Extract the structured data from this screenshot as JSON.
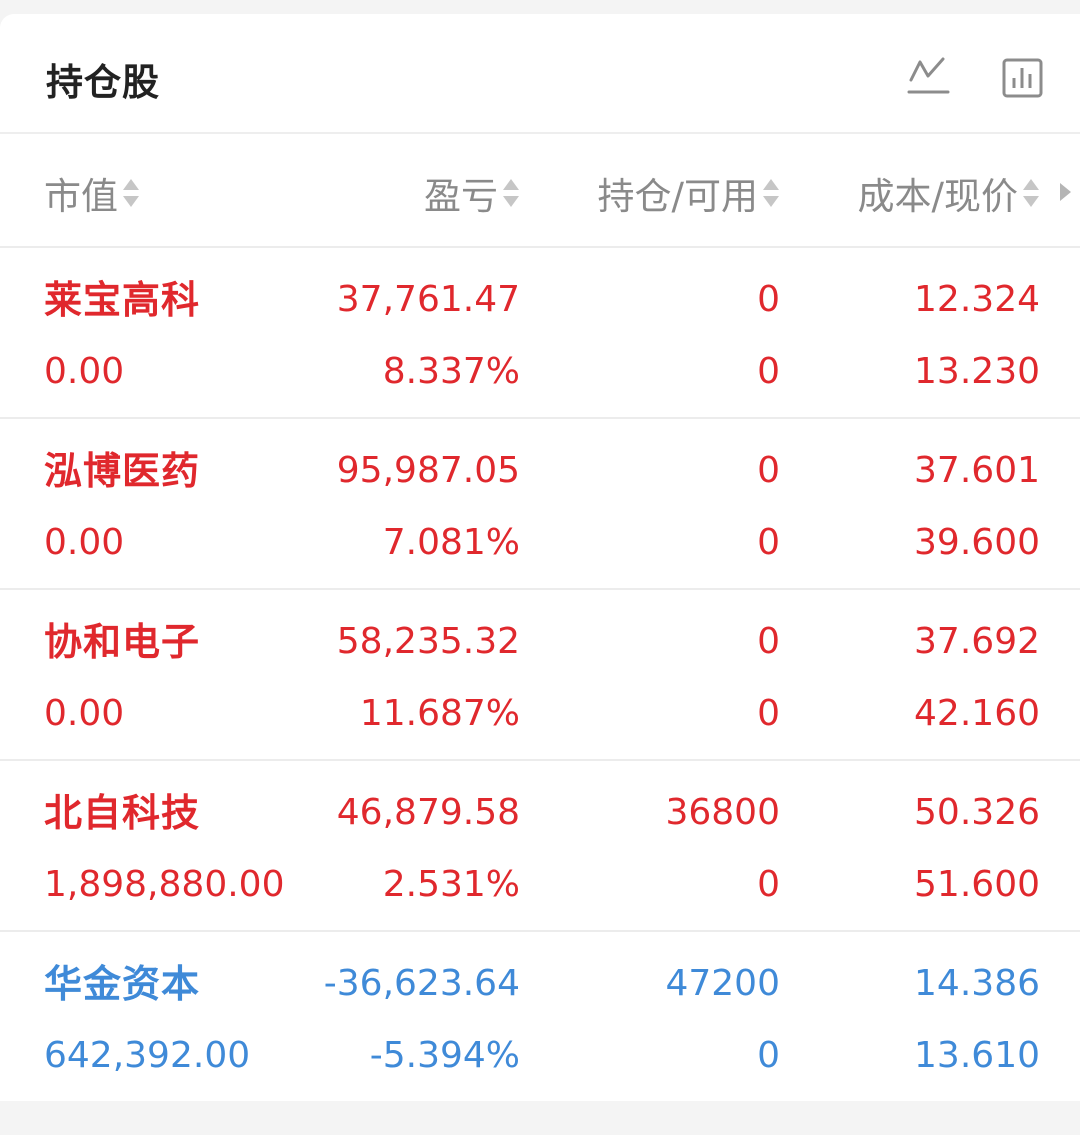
{
  "header": {
    "title": "持仓股",
    "icons": [
      "line-chart-icon",
      "bar-chart-icon"
    ]
  },
  "columns": [
    {
      "label": "市值"
    },
    {
      "label": "盈亏"
    },
    {
      "label": "持仓/可用"
    },
    {
      "label": "成本/现价"
    }
  ],
  "colors": {
    "gain": "#e0282d",
    "loss": "#3f8ad8"
  },
  "rows": [
    {
      "name": "莱宝高科",
      "market_value": "0.00",
      "pl": "37,761.47",
      "pl_pct": "8.337%",
      "position": "0",
      "available": "0",
      "cost": "12.324",
      "price": "13.230",
      "trend": "up"
    },
    {
      "name": "泓博医药",
      "market_value": "0.00",
      "pl": "95,987.05",
      "pl_pct": "7.081%",
      "position": "0",
      "available": "0",
      "cost": "37.601",
      "price": "39.600",
      "trend": "up"
    },
    {
      "name": "协和电子",
      "market_value": "0.00",
      "pl": "58,235.32",
      "pl_pct": "11.687%",
      "position": "0",
      "available": "0",
      "cost": "37.692",
      "price": "42.160",
      "trend": "up"
    },
    {
      "name": "北自科技",
      "market_value": "1,898,880.00",
      "pl": "46,879.58",
      "pl_pct": "2.531%",
      "position": "36800",
      "available": "0",
      "cost": "50.326",
      "price": "51.600",
      "trend": "up"
    },
    {
      "name": "华金资本",
      "market_value": "642,392.00",
      "pl": "-36,623.64",
      "pl_pct": "-5.394%",
      "position": "47200",
      "available": "0",
      "cost": "14.386",
      "price": "13.610",
      "trend": "down"
    }
  ]
}
